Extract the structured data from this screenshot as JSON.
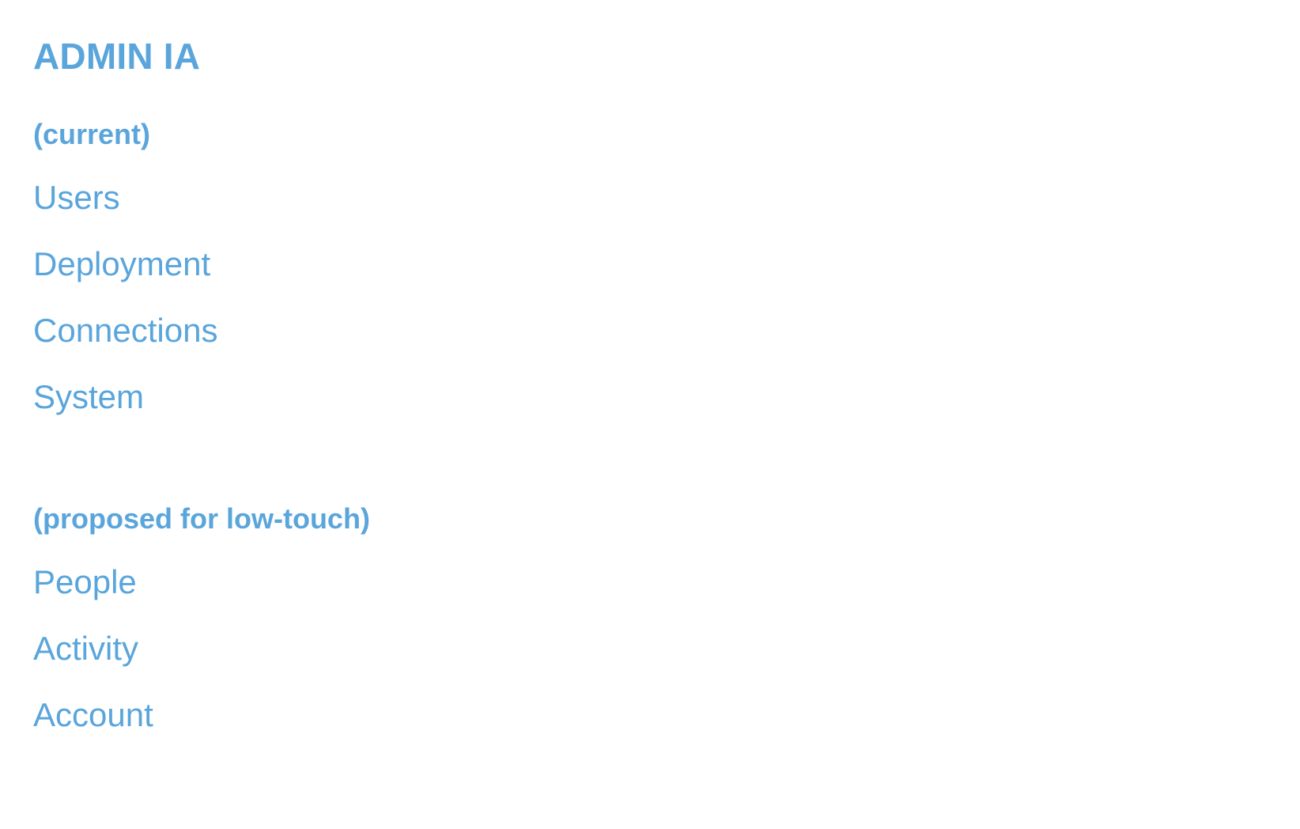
{
  "page": {
    "title": "ADMIN IA",
    "background_color": "#ffffff",
    "accent_color": "#5aa5db"
  },
  "sections": [
    {
      "heading": "(current)",
      "items": [
        {
          "label": "Users"
        },
        {
          "label": "Deployment"
        },
        {
          "label": "Connections"
        },
        {
          "label": "System"
        }
      ]
    },
    {
      "heading": "(proposed for low-touch)",
      "items": [
        {
          "label": "People"
        },
        {
          "label": "Activity"
        },
        {
          "label": "Account"
        }
      ]
    }
  ]
}
